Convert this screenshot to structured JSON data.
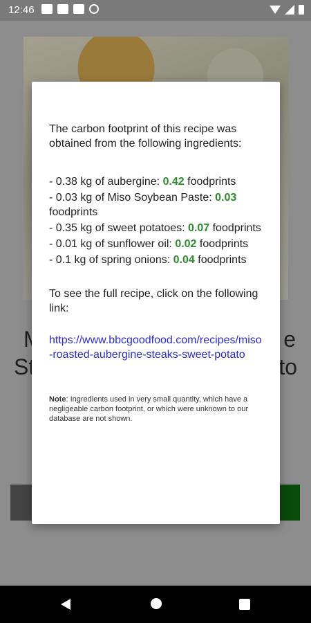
{
  "status_bar": {
    "time": "12:46",
    "left_icons": [
      "gmail-icon",
      "gmail-icon",
      "sim-card-icon",
      "blocked-icon"
    ],
    "right_icons": [
      "wifi-icon",
      "signal-icon",
      "battery-icon"
    ]
  },
  "background": {
    "recipe_title_partial": "M          e\nSt           to"
  },
  "dialog": {
    "intro": "The carbon footprint of this recipe was obtained from the following ingredients:",
    "ingredients": [
      {
        "text": "- 0.38 kg of aubergine: ",
        "value": "0.42",
        "unit": " foodprints"
      },
      {
        "text": "- 0.03 kg of Miso Soybean Paste: ",
        "value": "0.03",
        "unit": " foodprints"
      },
      {
        "text": "- 0.35 kg of sweet potatoes: ",
        "value": "0.07",
        "unit": " foodprints"
      },
      {
        "text": "- 0.01 kg of sunflower oil: ",
        "value": "0.02",
        "unit": " foodprints"
      },
      {
        "text": "- 0.1 kg of spring onions: ",
        "value": "0.04",
        "unit": " foodprints"
      }
    ],
    "see_full": "To see the full recipe, click on the following link:",
    "link": "https://www.bbcgoodfood.com/recipes/miso-roasted-aubergine-steaks-sweet-potato",
    "note_label": "Note",
    "note_text": ": Ingredients used in very small quantity, which have a negligeable carbon footprint, or which were unknown to our database are not shown."
  },
  "colors": {
    "value_green": "#2e8b2e",
    "link_blue": "#2b2bcf"
  }
}
